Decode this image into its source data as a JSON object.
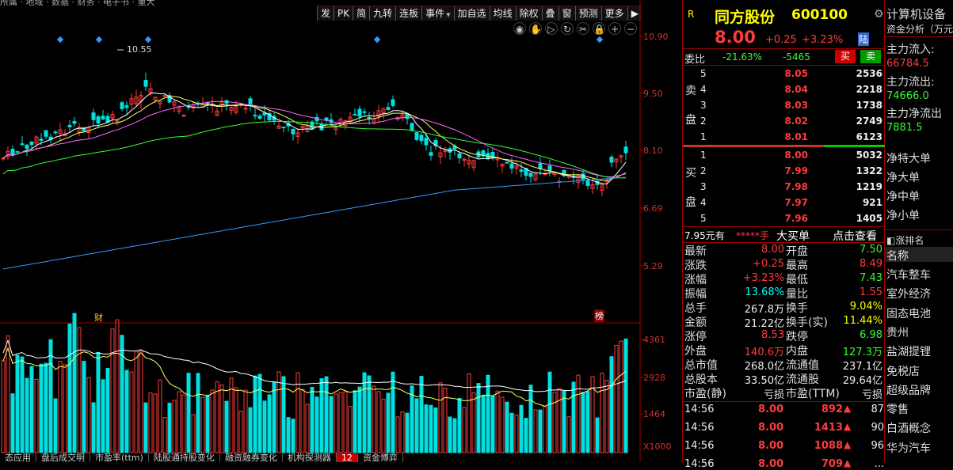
{
  "top_title": "所属 · 地域 · 数据 · 财务 · 电子书 · 重大",
  "toolbar": [
    "发",
    "PK",
    "简",
    "九转",
    "连板",
    "事件",
    "加自选",
    "均线",
    "除权",
    "叠",
    "窗",
    "预测",
    "更多",
    "▶"
  ],
  "toolbar_dropdowns": [
    5
  ],
  "chart_icons": [
    "eye-icon",
    "hand-icon",
    "replay-icon",
    "refresh-icon",
    "scissors-icon",
    "lock-icon",
    "zoom-in-icon",
    "zoom-out-icon"
  ],
  "price_axis": [
    "10.90",
    "9.50",
    "8.10",
    "6.69",
    "5.29"
  ],
  "volume_axis": [
    "4361",
    "2928",
    "1464",
    "X1000"
  ],
  "high_marker": "10.55",
  "marker_cai": "财",
  "marker_bang": "榜",
  "bottom_tabs": [
    "态应用",
    "盘后成交明",
    "市盈率(ttm)",
    "陆股通持股变化",
    "融资融券变化",
    "机构探测器",
    "资金博弈"
  ],
  "bottom_tab_badge": "12",
  "stock": {
    "badge": "R",
    "name": "同方股份",
    "code": "600100",
    "price": "8.00",
    "change": "+0.25",
    "change_pct": "+3.23%",
    "market_badge": "陆",
    "webi_label": "委比",
    "webi_pct": "-21.63%",
    "webi_diff": "-5465",
    "buy_btn": "买",
    "sell_btn": "卖"
  },
  "sell_side_label": [
    "卖",
    "盘"
  ],
  "buy_side_label": [
    "买",
    "盘"
  ],
  "sell_orders": [
    {
      "level": "5",
      "price": "8.05",
      "vol": "2536"
    },
    {
      "level": "4",
      "price": "8.04",
      "vol": "2218"
    },
    {
      "level": "3",
      "price": "8.03",
      "vol": "1738"
    },
    {
      "level": "2",
      "price": "8.02",
      "vol": "2749"
    },
    {
      "level": "1",
      "price": "8.01",
      "vol": "6123"
    }
  ],
  "buy_orders": [
    {
      "level": "1",
      "price": "8.00",
      "vol": "5032"
    },
    {
      "level": "2",
      "price": "7.99",
      "vol": "1322"
    },
    {
      "level": "3",
      "price": "7.98",
      "vol": "1219"
    },
    {
      "level": "4",
      "price": "7.97",
      "vol": "921"
    },
    {
      "level": "5",
      "price": "7.96",
      "vol": "1405"
    }
  ],
  "big_order": {
    "price": "7.95元有",
    "stars": "*****手",
    "label": "大买单",
    "link": "点击查看"
  },
  "stats": [
    [
      "最新",
      "8.00",
      "red",
      "开盘",
      "7.50",
      "green"
    ],
    [
      "涨跌",
      "+0.25",
      "red",
      "最高",
      "8.49",
      "red"
    ],
    [
      "涨幅",
      "+3.23%",
      "red",
      "最低",
      "7.43",
      "green"
    ],
    [
      "振幅",
      "13.68%",
      "cyan",
      "量比",
      "1.55",
      "red"
    ],
    [
      "总手",
      "267.8万",
      "white",
      "换手",
      "9.04%",
      "yellow"
    ],
    [
      "金额",
      "21.22亿",
      "white",
      "换手(实)",
      "11.44%",
      "yellow"
    ],
    [
      "涨停",
      "8.53",
      "red",
      "跌停",
      "6.98",
      "green"
    ],
    [
      "外盘",
      "140.6万",
      "red",
      "内盘",
      "127.3万",
      "green"
    ],
    [
      "总市值",
      "268.0亿",
      "white",
      "流通值",
      "237.1亿",
      "white"
    ],
    [
      "总股本",
      "33.50亿",
      "white",
      "流通股",
      "29.64亿",
      "white"
    ],
    [
      "市盈(静)",
      "亏损",
      "white",
      "市盈(TTM)",
      "亏损",
      "white"
    ]
  ],
  "ticks": [
    {
      "time": "14:56",
      "price": "8.00",
      "vol": "892",
      "n": "87"
    },
    {
      "time": "14:56",
      "price": "8.00",
      "vol": "1413",
      "n": "90"
    },
    {
      "time": "14:56",
      "price": "8.00",
      "vol": "1088",
      "n": "96"
    },
    {
      "time": "14:56",
      "price": "8.00",
      "vol": "709",
      "n": "..."
    }
  ],
  "sidebar": {
    "industry": "计算机设备",
    "fund_title": "资金分析（万元",
    "inflow_label": "主力流入:",
    "inflow": "66784.5",
    "outflow_label": "主力流出:",
    "outflow": "74666.0",
    "net_label": "主力净流出",
    "net": "7881.5",
    "flows": [
      "净特大单",
      "净大单",
      "净中单",
      "净小单"
    ],
    "rank_header": "◧涨排名",
    "name_header": "名称",
    "concepts": [
      "汽车整车",
      "室外经济",
      "固态电池",
      "贵州",
      "盐湖提锂",
      "免税店",
      "超级品牌",
      "零售",
      "白酒概念",
      "华为汽车"
    ]
  },
  "colors": {
    "up": "#ff3b3b",
    "down": "#00e0e0",
    "bg": "#000000",
    "ma5": "#ffffff",
    "ma10": "#ffff66",
    "ma20": "#ff66ff",
    "ma60": "#33ff33",
    "ma120": "#3399ff"
  }
}
